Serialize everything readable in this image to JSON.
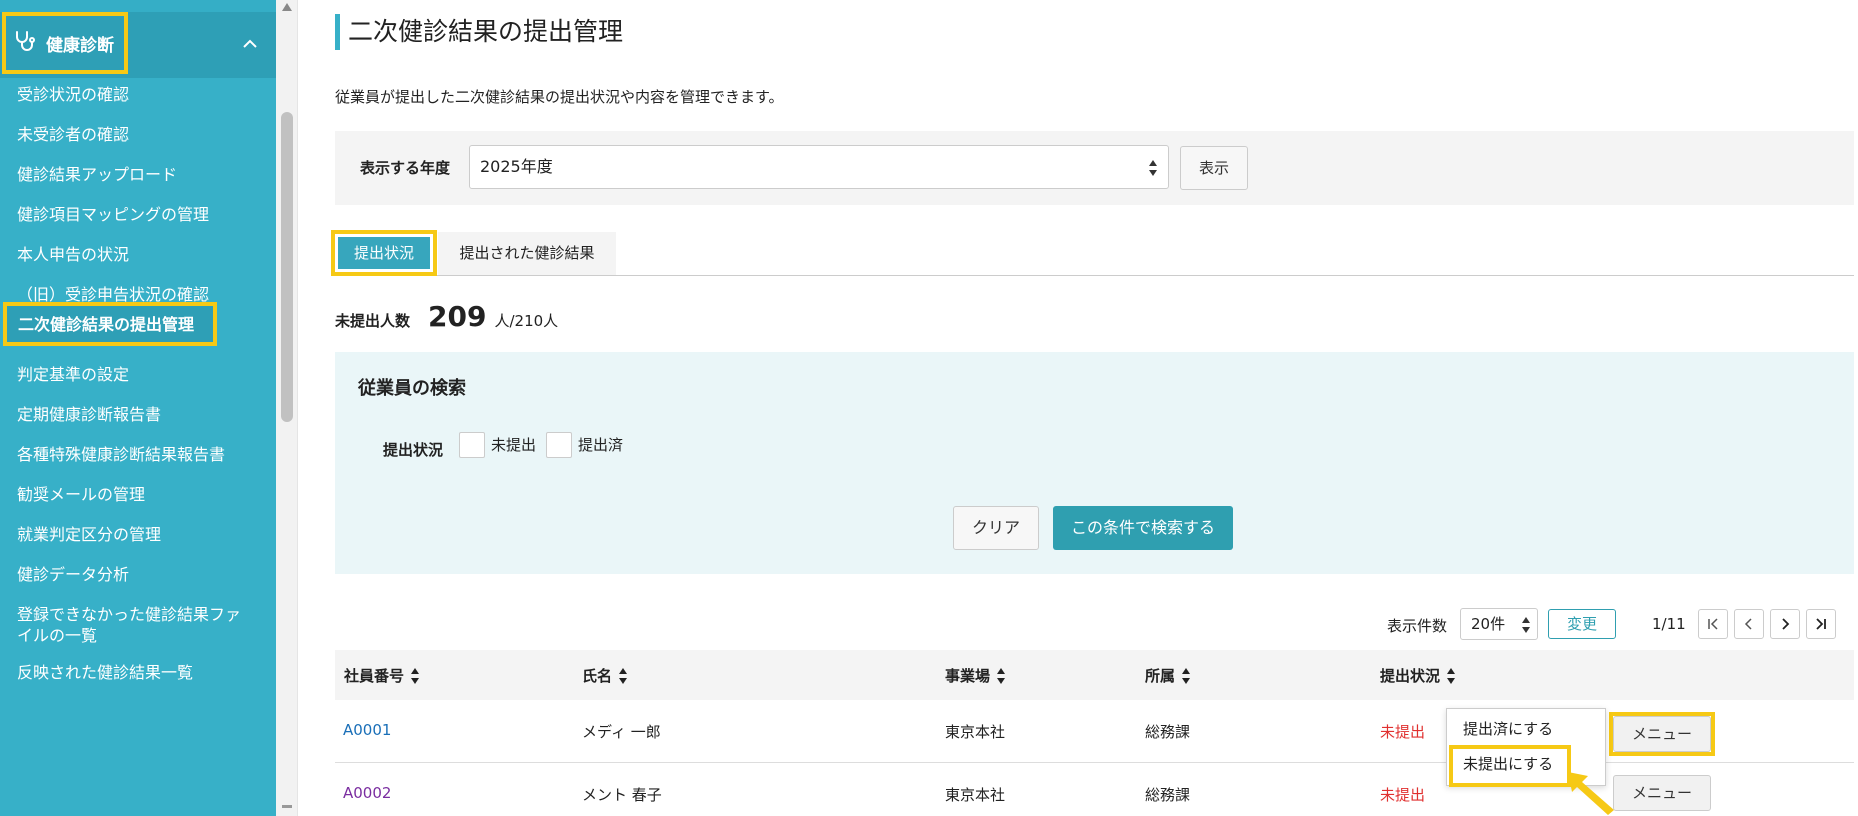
{
  "sidebar": {
    "section_title": "健康診断",
    "items": [
      "受診状況の確認",
      "未受診者の確認",
      "健診結果アップロード",
      "健診項目マッピングの管理",
      "本人申告の状況",
      "（旧）受診申告状況の確認",
      "二次健診結果の提出管理",
      "判定基準の設定",
      "定期健康診断報告書",
      "各種特殊健康診断結果報告書",
      "勧奨メールの管理",
      "就業判定区分の管理",
      "健診データ分析",
      "登録できなかった健診結果ファ",
      "イルの一覧",
      "反映された健診結果一覧"
    ]
  },
  "page": {
    "title": "二次健診結果の提出管理",
    "description": "従業員が提出した二次健診結果の提出状況や内容を管理できます。"
  },
  "year_filter": {
    "label": "表示する年度",
    "selected": "2025年度",
    "show_button": "表示"
  },
  "tabs": {
    "active": "提出状況",
    "inactive": "提出された健診結果"
  },
  "counts": {
    "label": "未提出人数",
    "value": "209",
    "unit": "人/210人"
  },
  "search": {
    "title": "従業員の検索",
    "status_label": "提出状況",
    "option_unsubmitted": "未提出",
    "option_submitted": "提出済",
    "clear_button": "クリア",
    "search_button": "この条件で検索する"
  },
  "pager": {
    "per_page_label": "表示件数",
    "per_page_value": "20件",
    "change_button": "変更",
    "page_info": "1/11",
    "first": "|<",
    "prev": "<",
    "next": ">",
    "last": ">|"
  },
  "table": {
    "headers": {
      "id": "社員番号",
      "name": "氏名",
      "office": "事業場",
      "dept": "所属",
      "status": "提出状況"
    },
    "rows": [
      {
        "id": "A0001",
        "name": "メディ 一郎",
        "office": "東京本社",
        "dept": "総務課",
        "status": "未提出",
        "menu": "メニュー"
      },
      {
        "id": "A0002",
        "name": "メント 春子",
        "office": "東京本社",
        "dept": "総務課",
        "status": "未提出",
        "menu": "メニュー"
      }
    ]
  },
  "dropdown": {
    "item_submitted": "提出済にする",
    "item_unsubmitted": "未提出にする"
  },
  "colors": {
    "sidebar_bg": "#37b0c8",
    "accent": "#2f9fb0",
    "highlight": "#f6c915",
    "status_red": "#e0302f"
  }
}
